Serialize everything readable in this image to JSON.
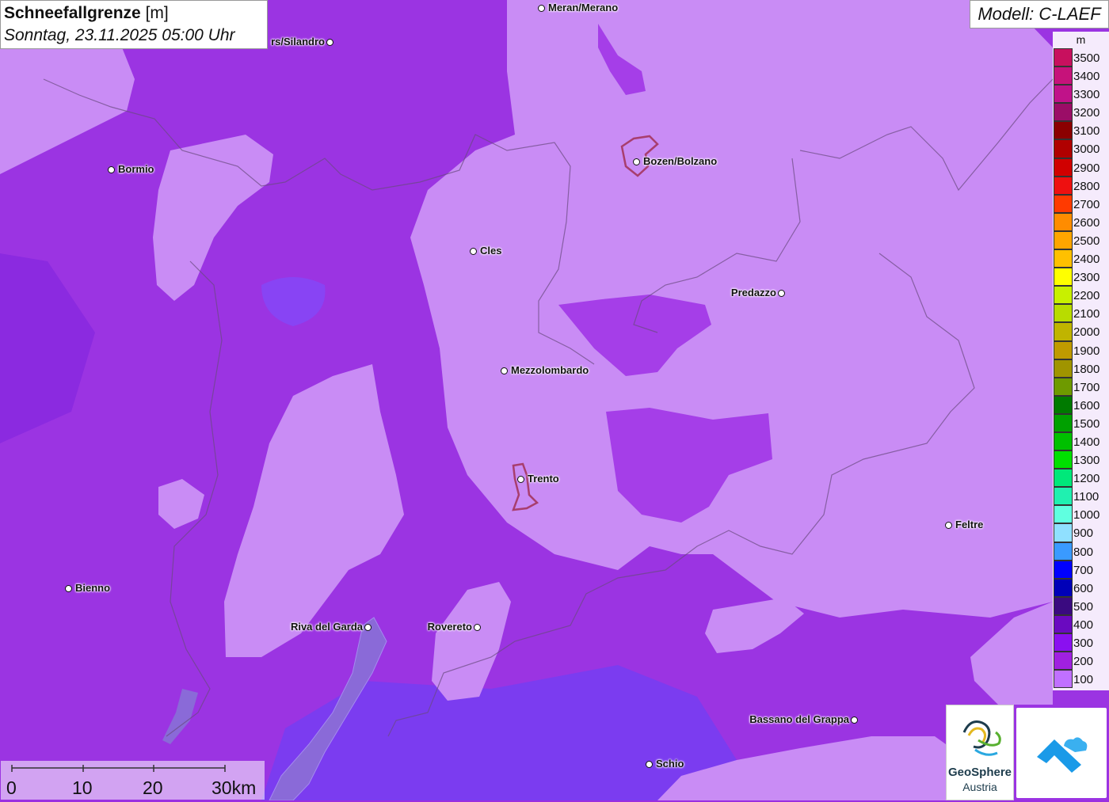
{
  "title": {
    "main": "Schneefallgrenze",
    "unit": "[m]",
    "datetime": "Sonntag, 23.11.2025 05:00 Uhr"
  },
  "model": "Modell: C-LAEF",
  "legend": {
    "unit": "m",
    "items": [
      {
        "label": "3500",
        "color": "#c8105e"
      },
      {
        "label": "3400",
        "color": "#c6127a"
      },
      {
        "label": "3300",
        "color": "#c01289"
      },
      {
        "label": "3200",
        "color": "#9b0d67"
      },
      {
        "label": "3100",
        "color": "#8b0000"
      },
      {
        "label": "3000",
        "color": "#b00000"
      },
      {
        "label": "2900",
        "color": "#d00000"
      },
      {
        "label": "2800",
        "color": "#ee1010"
      },
      {
        "label": "2700",
        "color": "#ff3a00"
      },
      {
        "label": "2600",
        "color": "#ff8c00"
      },
      {
        "label": "2500",
        "color": "#ffa500"
      },
      {
        "label": "2400",
        "color": "#ffc000"
      },
      {
        "label": "2300",
        "color": "#ffff00"
      },
      {
        "label": "2200",
        "color": "#c8f000"
      },
      {
        "label": "2100",
        "color": "#b8dc00"
      },
      {
        "label": "2000",
        "color": "#c0b400"
      },
      {
        "label": "1900",
        "color": "#c09a00"
      },
      {
        "label": "1800",
        "color": "#a09400"
      },
      {
        "label": "1700",
        "color": "#6e9a00"
      },
      {
        "label": "1600",
        "color": "#007a00"
      },
      {
        "label": "1500",
        "color": "#00a000"
      },
      {
        "label": "1400",
        "color": "#00c000"
      },
      {
        "label": "1300",
        "color": "#00e000"
      },
      {
        "label": "1200",
        "color": "#00e87a"
      },
      {
        "label": "1100",
        "color": "#20f0b0"
      },
      {
        "label": "1000",
        "color": "#60ffe0"
      },
      {
        "label": "900",
        "color": "#90e0ff"
      },
      {
        "label": "800",
        "color": "#3a9aff"
      },
      {
        "label": "700",
        "color": "#0000ff"
      },
      {
        "label": "600",
        "color": "#0000b8"
      },
      {
        "label": "500",
        "color": "#3a0a80"
      },
      {
        "label": "400",
        "color": "#6a0ac0"
      },
      {
        "label": "300",
        "color": "#8a10f0"
      },
      {
        "label": "200",
        "color": "#a020e0"
      },
      {
        "label": "100",
        "color": "#c070ff"
      }
    ]
  },
  "cities": [
    {
      "name": "Meran/Merano",
      "side": "right"
    },
    {
      "name": "rs/Silandro",
      "side": "left"
    },
    {
      "name": "Bormio",
      "side": "right"
    },
    {
      "name": "Bozen/Bolzano",
      "side": "right"
    },
    {
      "name": "Cles",
      "side": "right"
    },
    {
      "name": "Predazzo",
      "side": "left"
    },
    {
      "name": "Mezzolombardo",
      "side": "right"
    },
    {
      "name": "Trento",
      "side": "right"
    },
    {
      "name": "Feltre",
      "side": "right"
    },
    {
      "name": "Bienno",
      "side": "right"
    },
    {
      "name": "Riva del Garda",
      "side": "left"
    },
    {
      "name": "Rovereto",
      "side": "left"
    },
    {
      "name": "Bassano del Grappa",
      "side": "left"
    },
    {
      "name": "Schio",
      "side": "right"
    }
  ],
  "scalebar": {
    "labels": [
      "0",
      "10",
      "20",
      "30km"
    ]
  },
  "logo": {
    "name": "GeoSphere",
    "sub": "Austria"
  },
  "colors": {
    "light_zone": "#c98cf5",
    "mid_zone": "#a53ee8",
    "dark_zone": "#8a2ee0",
    "low_zone": "#7a36f0",
    "lake": "#8a6ad8"
  }
}
